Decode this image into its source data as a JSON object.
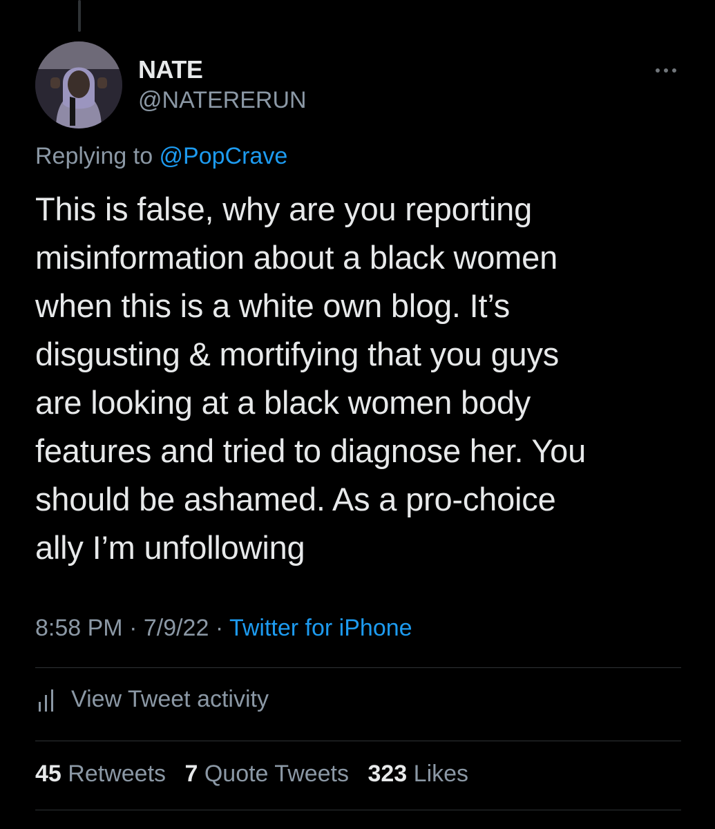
{
  "user": {
    "name": "NATE",
    "handle": "@NATERERUN"
  },
  "reply": {
    "prefix": "Replying to ",
    "to": "@PopCrave"
  },
  "tweet": {
    "text": "This is false, why are you reporting\nmisinformation about a black women\nwhen this is a white own blog. It’s\ndisgusting & mortifying that you guys\nare looking at a black women body\nfeatures and tried to diagnose her. You\nshould be ashamed. As a pro-choice\nally I’m unfollowing"
  },
  "meta": {
    "time": "8:58 PM",
    "sep1": " · ",
    "date": "7/9/22",
    "sep2": " · ",
    "source": "Twitter for iPhone"
  },
  "activity": {
    "icon": "bar-chart-icon",
    "label": "View Tweet activity"
  },
  "stats": {
    "retweets_count": "45",
    "retweets_label": "Retweets",
    "quotes_count": "7",
    "quotes_label": "Quote Tweets",
    "likes_count": "323",
    "likes_label": "Likes"
  },
  "colors": {
    "background": "#000000",
    "text": "#e7e9ea",
    "muted": "#8b98a5",
    "link": "#1d9bf0",
    "divider": "#2f3336"
  }
}
